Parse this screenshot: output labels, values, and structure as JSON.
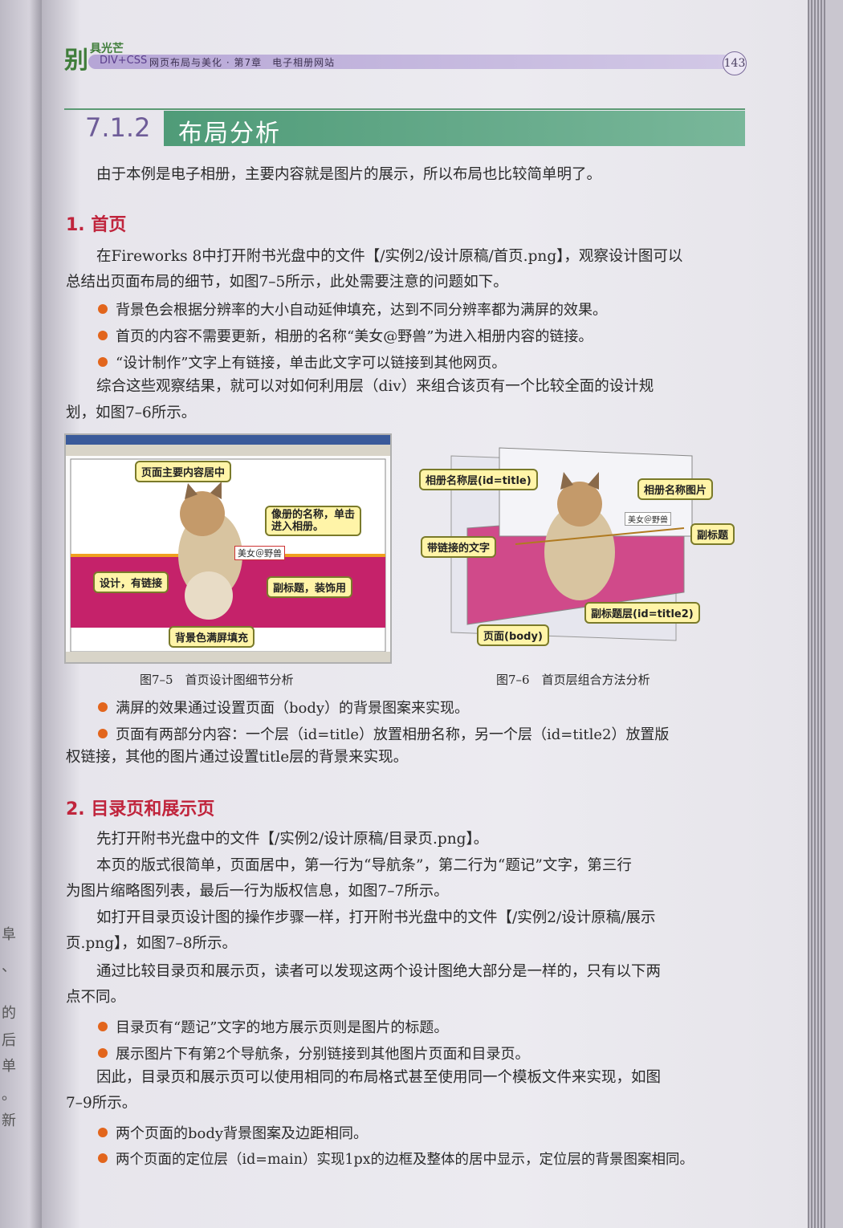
{
  "left_margin_fragments": [
    "阜",
    "、",
    "的",
    "后",
    "单",
    "。",
    "新"
  ],
  "header": {
    "logo_char": "别",
    "brand": "具光芒",
    "course": "DIV+CSS",
    "chapter": "网页布局与美化 · 第7章　电子相册网站",
    "page_number": "143"
  },
  "section": {
    "number": "7.1.2",
    "title": "布局分析"
  },
  "intro": "由于本例是电子相册，主要内容就是图片的展示，所以布局也比较简单明了。",
  "part1": {
    "heading": "1. 首页",
    "para1_line1": "在Fireworks 8中打开附书光盘中的文件【/实例2/设计原稿/首页.png】，观察设计图可以",
    "para1_line2": "总结出页面布局的细节，如图7–5所示，此处需要注意的问题如下。",
    "bullets": [
      "背景色会根据分辨率的大小自动延伸填充，达到不同分辨率都为满屏的效果。",
      "首页的内容不需要更新，相册的名称“美女@野兽”为进入相册内容的链接。",
      "“设计制作”文字上有链接，单击此文字可以链接到其他网页。"
    ],
    "para2_line1": "综合这些观察结果，就可以对如何利用层（div）来组合该页有一个比较全面的设计规",
    "para2_line2": "划，如图7–6所示。"
  },
  "figure5": {
    "caption": "图7–5　首页设计图细节分析",
    "callouts": {
      "main": "页面主要内容居中",
      "album_name": "像册的名称，单击进入相册。",
      "design": "设计，有链接",
      "subtitle": "副标题，装饰用",
      "background": "背景色满屏填充"
    },
    "album_text": "美女＠野兽"
  },
  "figure6": {
    "caption": "图7–6　首页层组合方法分析",
    "callouts": {
      "title_layer": "相册名称层(id=title)",
      "title_image": "相册名称图片",
      "link_text": "带链接的文字",
      "subtitle": "副标题",
      "subtitle_layer": "副标题层(id=title2)",
      "body": "页面(body)"
    },
    "album_text": "美女＠野兽"
  },
  "after_figs": {
    "bullet1": "满屏的效果通过设置页面（body）的背景图案来实现。",
    "bullet2_line1": "页面有两部分内容：一个层（id=title）放置相册名称，另一个层（id=title2）放置版",
    "bullet2_line2": "权链接，其他的图片通过设置title层的背景来实现。"
  },
  "part2": {
    "heading": "2. 目录页和展示页",
    "lines": [
      "先打开附书光盘中的文件【/实例2/设计原稿/目录页.png】。",
      "本页的版式很简单，页面居中，第一行为“导航条”，第二行为“题记”文字，第三行",
      "为图片缩略图列表，最后一行为版权信息，如图7–7所示。",
      "如打开目录页设计图的操作步骤一样，打开附书光盘中的文件【/实例2/设计原稿/展示",
      "页.png】，如图7–8所示。",
      "通过比较目录页和展示页，读者可以发现这两个设计图绝大部分是一样的，只有以下两",
      "点不同。"
    ],
    "bullets_a": [
      "目录页有“题记”文字的地方展示页则是图片的标题。",
      "展示图片下有第2个导航条，分别链接到其他图片页面和目录页。"
    ],
    "lines2": [
      "因此，目录页和展示页可以使用相同的布局格式甚至使用同一个模板文件来实现，如图",
      "7–9所示。"
    ],
    "bullets_b": [
      "两个页面的body背景图案及边距相同。",
      "两个页面的定位层（id=main）实现1px的边框及整体的居中显示，定位层的背景图案相同。"
    ]
  },
  "colors": {
    "accent_green": "#4f9b78",
    "heading_red": "#c0243c",
    "bullet_orange": "#e2651c",
    "header_purple": "#b6a6d6"
  }
}
